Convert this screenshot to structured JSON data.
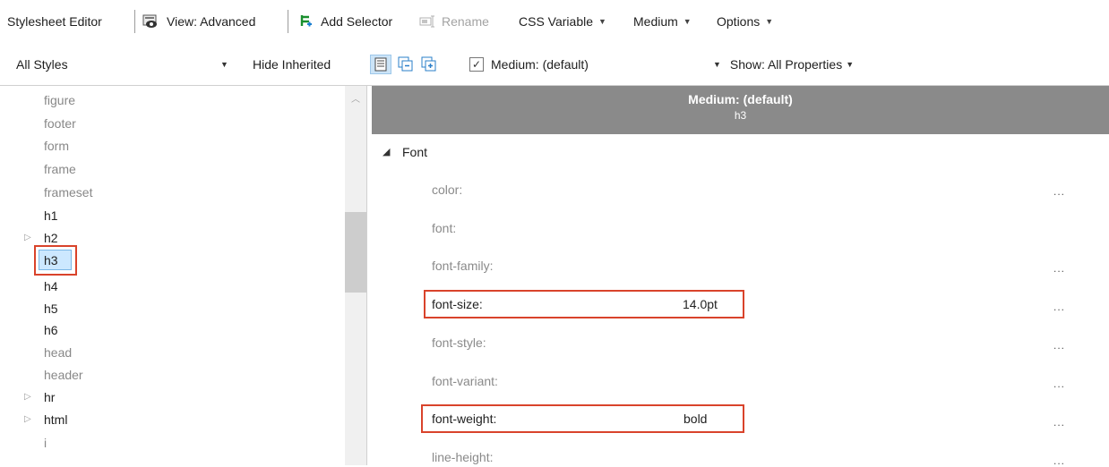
{
  "toolbar": {
    "title": "Stylesheet Editor",
    "view": "View: Advanced",
    "add_selector": "Add Selector",
    "rename": "Rename",
    "css_variable": "CSS Variable",
    "medium": "Medium",
    "options": "Options"
  },
  "toolbar2": {
    "styles_select": "All Styles",
    "hide_inherited": "Hide Inherited",
    "medium_check": "Medium: (default)",
    "show": "Show: All Properties"
  },
  "tree": {
    "items": [
      "figure",
      "footer",
      "form",
      "frame",
      "frameset",
      "h1",
      "h2",
      "h3",
      "h4",
      "h5",
      "h6",
      "head",
      "header",
      "hr",
      "html",
      "i"
    ]
  },
  "panel": {
    "header_title": "Medium: (default)",
    "header_sub": "h3",
    "group": "Font",
    "props": [
      {
        "name": "color:",
        "value": ""
      },
      {
        "name": "font:",
        "value": ""
      },
      {
        "name": "font-family:",
        "value": ""
      },
      {
        "name": "font-size:",
        "value": "14.0pt"
      },
      {
        "name": "font-style:",
        "value": ""
      },
      {
        "name": "font-variant:",
        "value": ""
      },
      {
        "name": "font-weight:",
        "value": "bold"
      },
      {
        "name": "line-height:",
        "value": ""
      }
    ],
    "more": "..."
  },
  "colors": {
    "highlight": "#d9432b",
    "header_bg": "#8a8a8a",
    "selection": "#cce8ff"
  }
}
